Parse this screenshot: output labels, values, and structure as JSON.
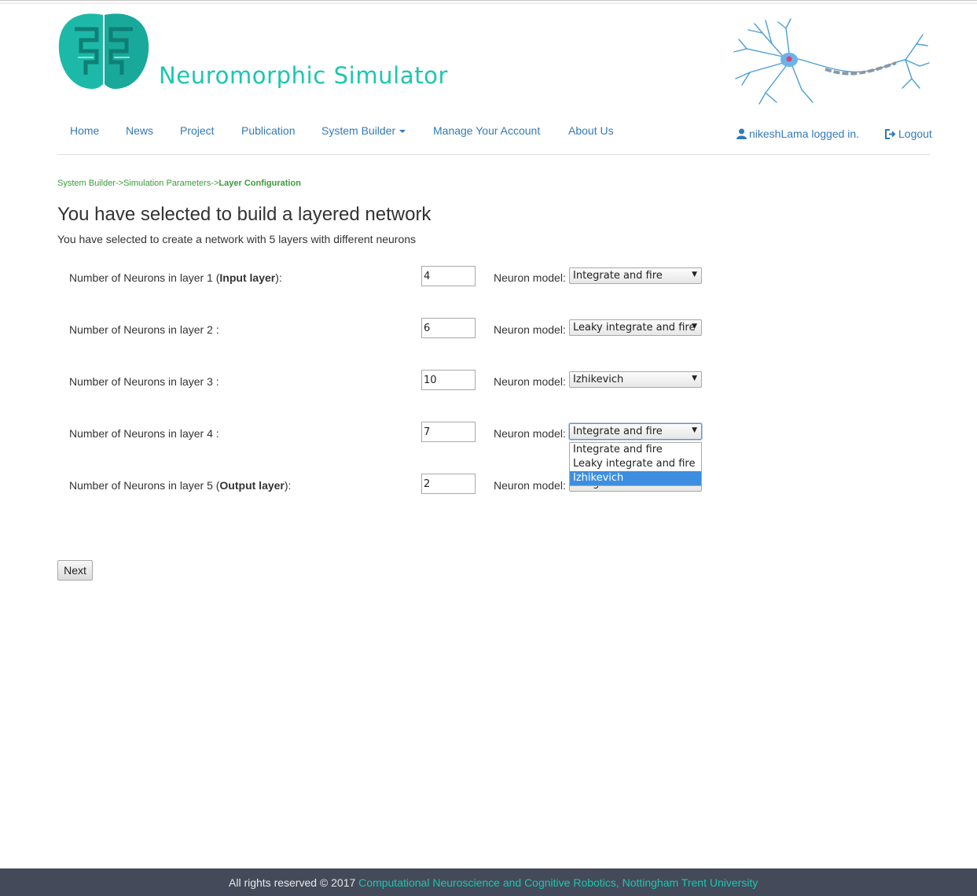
{
  "header": {
    "site_title": "Neuromorphic Simulator",
    "logo_icon": "brain-logo-icon",
    "neuron_image": "neuron-illustration",
    "brand_color": "#1bc6b1"
  },
  "nav": {
    "items": [
      {
        "label": "Home"
      },
      {
        "label": "News"
      },
      {
        "label": "Project"
      },
      {
        "label": "Publication"
      },
      {
        "label": "System Builder"
      },
      {
        "label": "Manage Your Account"
      },
      {
        "label": "About Us"
      }
    ],
    "user_status": "nikeshLama logged in.",
    "logout_label": "Logout",
    "link_color": "#337ab7"
  },
  "breadcrumb": {
    "step1": "System Builder->",
    "step2": "Simulation Parameters->",
    "current": "Layer Configuration"
  },
  "page": {
    "title": "You have selected to build a layered network",
    "subtitle": "You have selected to create a network with 5 layers with different neurons"
  },
  "layers": [
    {
      "label_prefix": "Number of Neurons in layer 1 (",
      "label_bold": "Input layer",
      "label_suffix": "):",
      "count": "4",
      "model_label": "Neuron model:",
      "model": "Integrate and fire"
    },
    {
      "label_prefix": "Number of Neurons in layer 2 :",
      "label_bold": "",
      "label_suffix": "",
      "count": "6",
      "model_label": "Neuron model:",
      "model": "Leaky integrate and fire"
    },
    {
      "label_prefix": "Number of Neurons in layer 3 :",
      "label_bold": "",
      "label_suffix": "",
      "count": "10",
      "model_label": "Neuron model:",
      "model": "Izhikevich"
    },
    {
      "label_prefix": "Number of Neurons in layer 4 :",
      "label_bold": "",
      "label_suffix": "",
      "count": "7",
      "model_label": "Neuron model:",
      "model": "Integrate and fire"
    },
    {
      "label_prefix": "Number of Neurons in layer 5 (",
      "label_bold": "Output layer",
      "label_suffix": "):",
      "count": "2",
      "model_label": "Neuron model:",
      "model": "Integrate and fire"
    }
  ],
  "dropdown": {
    "options": [
      "Integrate and fire",
      "Leaky integrate and fire",
      "Izhikevich"
    ],
    "highlighted": "Izhikevich"
  },
  "actions": {
    "next_label": "Next"
  },
  "footer": {
    "text": "All rights reserved © 2017 ",
    "link": "Computational Neuroscience and Cognitive Robotics, Nottingham Trent University"
  }
}
